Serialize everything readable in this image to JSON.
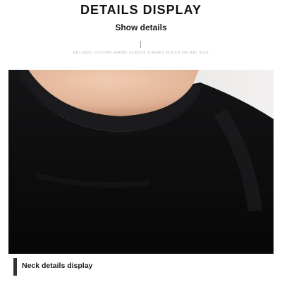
{
  "header": {
    "title": "DETAILS DISPLAY",
    "subtitle": "Show details",
    "tagline": "BIG SIZE COTTON SHORT SLEEVE T-SHIRT FOCUS ON BIG SIZE"
  },
  "photo": {
    "subject": "black-tshirt-neckline",
    "colors": {
      "shirt": "#0d0d0f",
      "skin": "#e8c2a8",
      "background": "#ecebea"
    }
  },
  "caption": {
    "label": "Neck details display"
  }
}
